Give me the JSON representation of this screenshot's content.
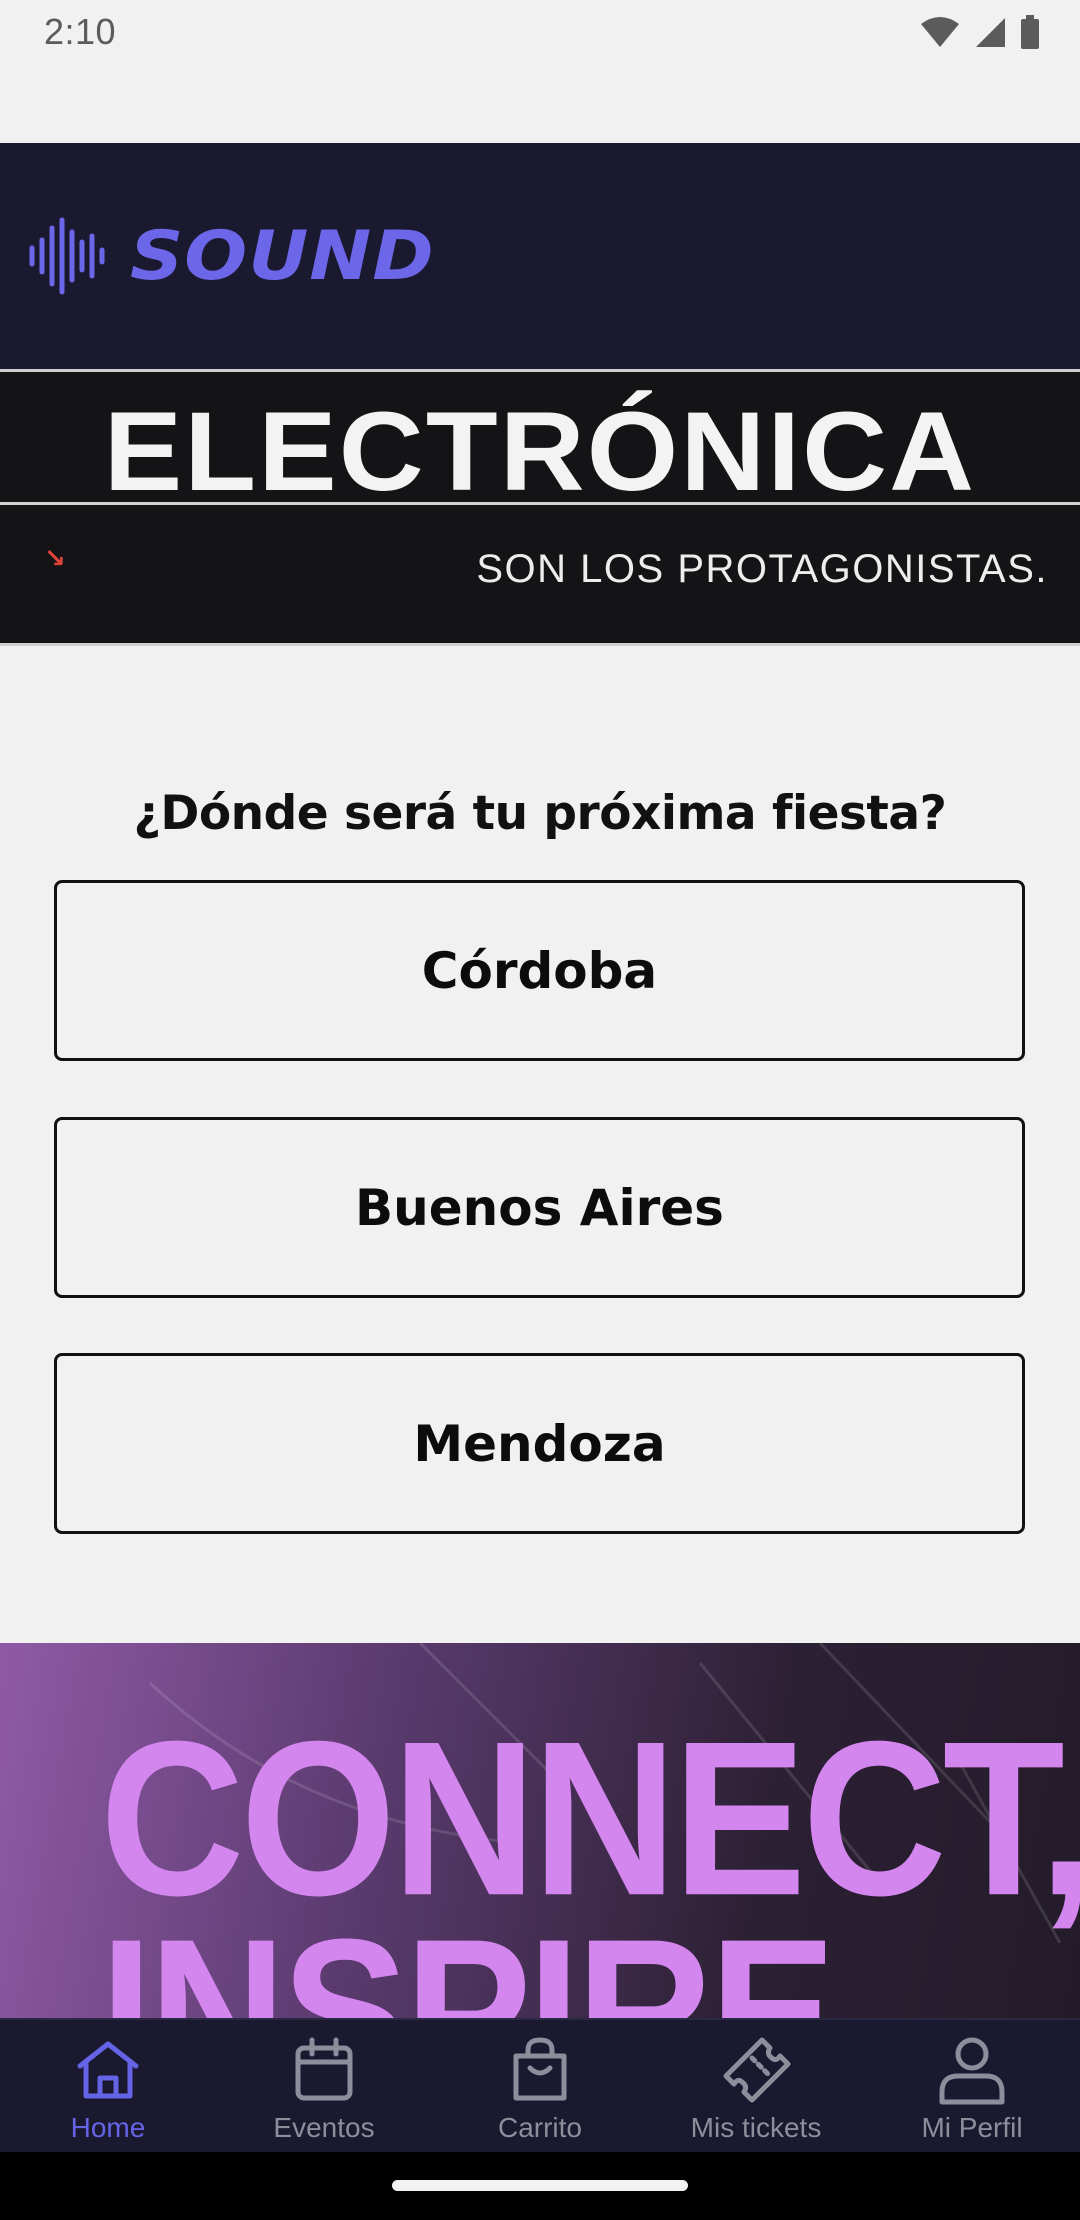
{
  "status_bar": {
    "time": "2:10"
  },
  "header": {
    "logo_text": "SOUND",
    "brand_color": "#6c66e8",
    "icon": "sound-wave-icon"
  },
  "banner": {
    "title": "ELECTRÓNICA",
    "subtitle": "SON LOS PROTAGONISTAS."
  },
  "city_select": {
    "question": "¿Dónde será tu próxima fiesta?",
    "cities": [
      "Córdoba",
      "Buenos Aires",
      "Mendoza"
    ]
  },
  "promo": {
    "line1": "CONNECT,",
    "line2": "INSPIRE",
    "color": "#d486ef"
  },
  "bottom_nav": {
    "active_color": "#6664e6",
    "items": [
      {
        "label": "Home",
        "icon": "home-icon",
        "active": true
      },
      {
        "label": "Eventos",
        "icon": "calendar-icon",
        "active": false
      },
      {
        "label": "Carrito",
        "icon": "shopping-bag-icon",
        "active": false
      },
      {
        "label": "Mis tickets",
        "icon": "ticket-icon",
        "active": false
      },
      {
        "label": "Mi Perfil",
        "icon": "person-icon",
        "active": false
      }
    ]
  }
}
